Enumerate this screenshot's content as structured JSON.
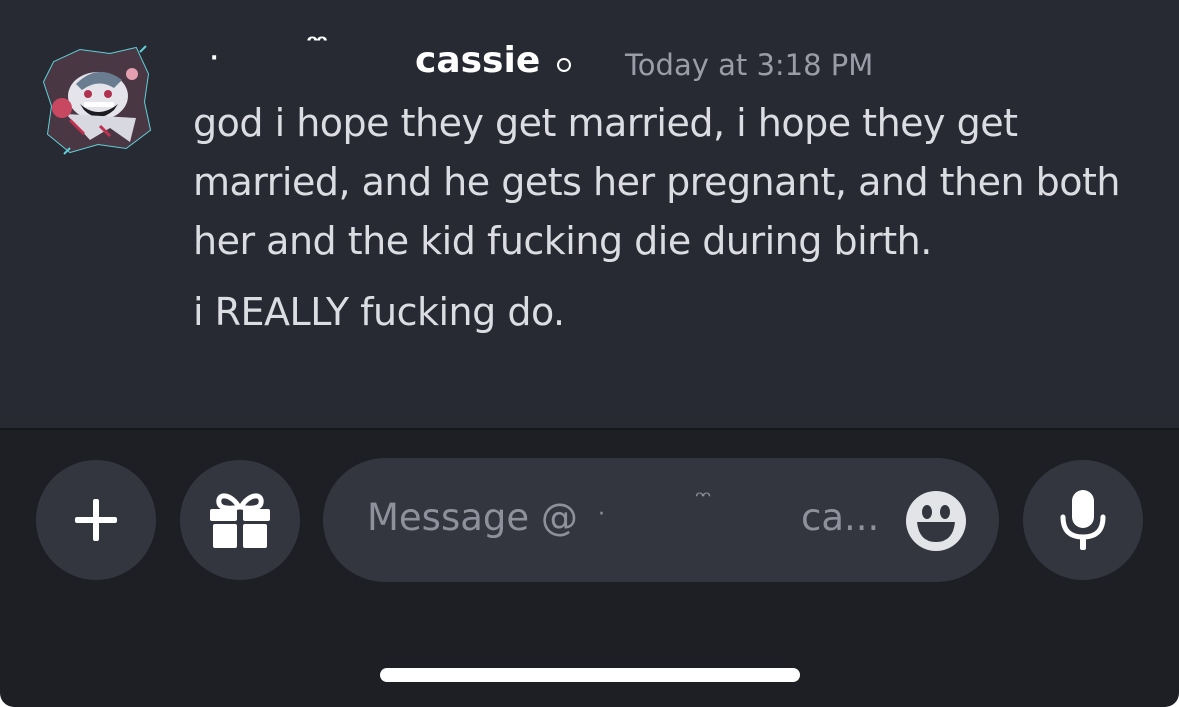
{
  "message": {
    "author": {
      "name_decor_left_1": "·",
      "name_decor_left_2": "ᵔᵔ",
      "name": "cassie",
      "avatar_icon": "avatar-icon"
    },
    "timestamp": "Today at 3:18 PM",
    "lines": [
      "god i hope they get married, i hope they get married, and he gets her pregnant, and then both her and the kid fucking die during birth.",
      "i REALLY fucking do."
    ],
    "line_1_wrapped": [
      "god i hope they get married, i hope they get",
      "married, and he gets her pregnant, and then both",
      "her and the kid fucking die during birth."
    ]
  },
  "composer": {
    "add_button_icon": "plus-icon",
    "gift_button_icon": "gift-icon",
    "placeholder_prefix": "Message @",
    "placeholder_deco_dot": "·",
    "placeholder_deco_curl": "ᵔᵔ",
    "placeholder_name": "ca...",
    "emoji_icon": "smile-emoji-icon",
    "mic_icon": "microphone-icon"
  },
  "colors": {
    "chat_background": "#282a33",
    "composer_background": "#1e1f25",
    "button_background": "#34363f",
    "text_primary": "#dcdde3",
    "text_muted": "#9a9ca8"
  }
}
